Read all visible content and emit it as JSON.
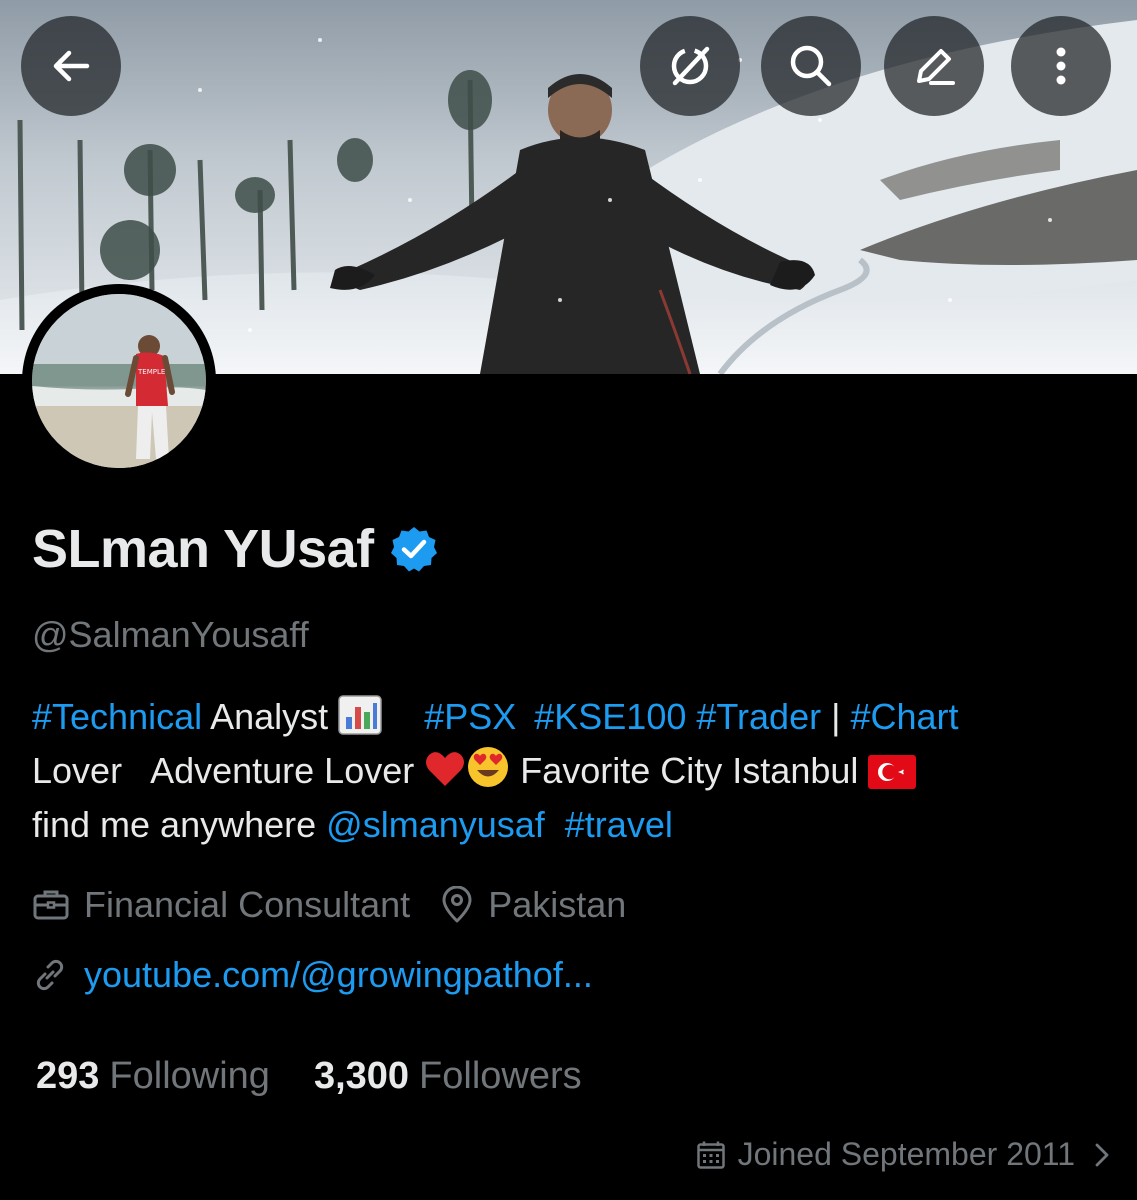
{
  "header": {
    "back_icon": "arrow-left-icon",
    "buttons": [
      "grok-icon",
      "search-icon",
      "edit-icon",
      "more-vertical-icon"
    ]
  },
  "profile": {
    "display_name": "SLman YUsaf",
    "verified": true,
    "handle": "@SalmanYousaff",
    "bio": {
      "tag_technical": "#Technical",
      "text_analyst": " Analyst ",
      "tag_psx": "#PSX",
      "tag_kse100": "#KSE100",
      "tag_trader": "#Trader",
      "separator": " | ",
      "tag_chart": "#Chart",
      "text_lover": "Lover   Adventure Lover ",
      "text_city": " Favorite City Istanbul ",
      "text_find": "find me anywhere ",
      "mention": "@slmanyusaf",
      "tag_travel": "#travel"
    },
    "profession": "Financial Consultant",
    "location": "Pakistan",
    "url": "youtube.com/@growingpathof...",
    "following_count": "293",
    "following_label": "Following",
    "followers_count": "3,300",
    "followers_label": "Followers",
    "joined": "Joined September 2011"
  },
  "colors": {
    "background": "#000000",
    "text": "#e7e9ea",
    "secondary": "#71767b",
    "accent": "#1d9bf0",
    "verified": "#1d9bf0"
  }
}
